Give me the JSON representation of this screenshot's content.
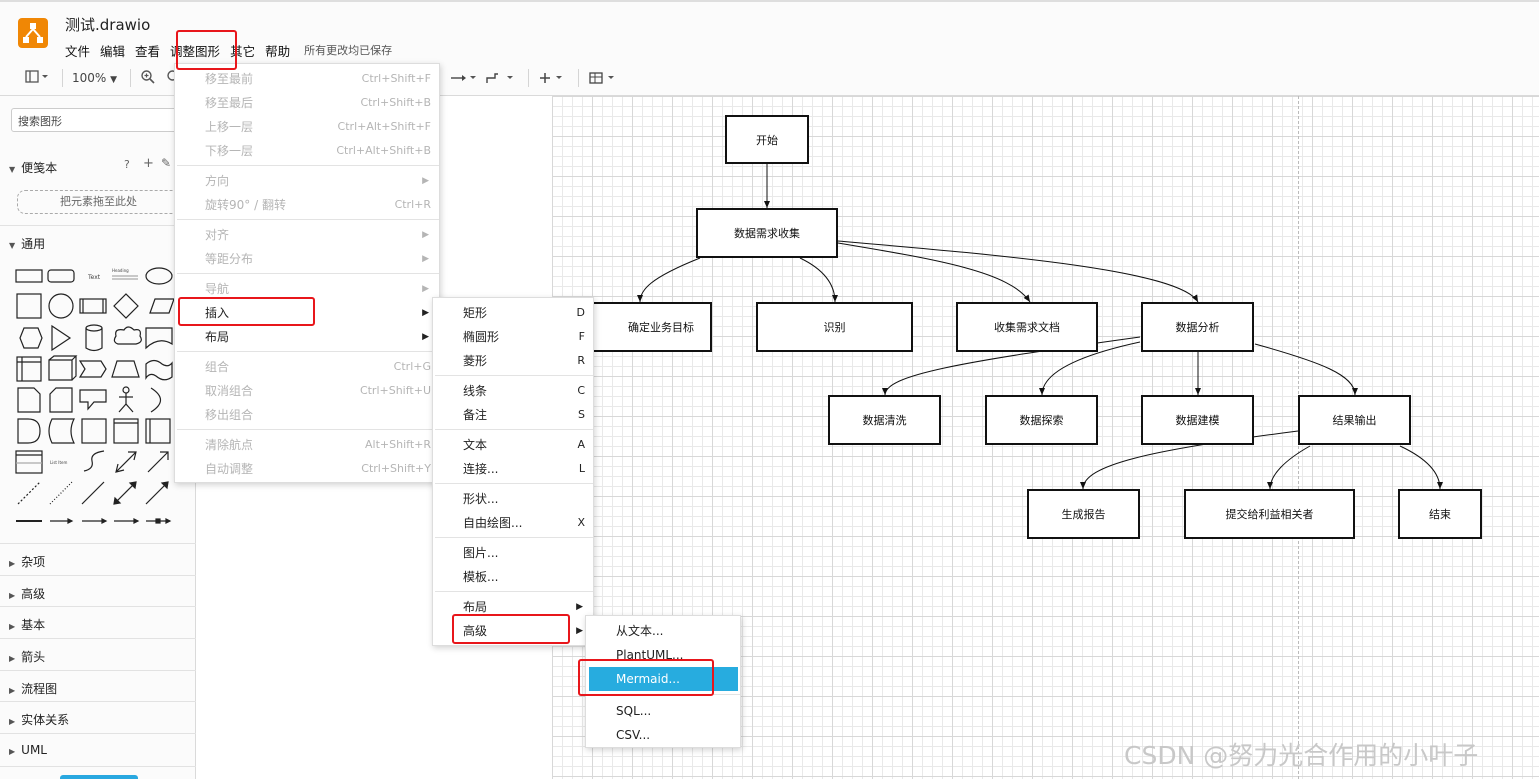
{
  "app": {
    "title": "测试.drawio",
    "saved_status": "所有更改均已保存"
  },
  "colors": {
    "brand": "#f08705",
    "highlight": "#27acdf",
    "annotation_red": "#e8161b"
  },
  "menubar": [
    "文件",
    "编辑",
    "查看",
    "调整图形",
    "其它",
    "帮助"
  ],
  "toolbar": {
    "zoom": "100%"
  },
  "sidebar": {
    "search_placeholder": "搜索图形",
    "scratchpad": "便笺本",
    "drop_hint": "把元素拖至此处",
    "general": "通用",
    "sections": [
      "杂项",
      "高级",
      "基本",
      "箭头",
      "流程图",
      "实体关系",
      "UML"
    ],
    "shape_text_sample": "Text",
    "shape_heading_sample": "Heading",
    "shape_list_sample": "List Item"
  },
  "arrange_menu": {
    "items": [
      {
        "label": "移至最前",
        "shortcut": "Ctrl+Shift+F",
        "disabled": true
      },
      {
        "label": "移至最后",
        "shortcut": "Ctrl+Shift+B",
        "disabled": true
      },
      {
        "label": "上移一层",
        "shortcut": "Ctrl+Alt+Shift+F",
        "disabled": true
      },
      {
        "label": "下移一层",
        "shortcut": "Ctrl+Alt+Shift+B",
        "disabled": true
      },
      {
        "label": "方向",
        "shortcut": "",
        "disabled": true,
        "submenu": true
      },
      {
        "label": "旋转90° / 翻转",
        "shortcut": "Ctrl+R",
        "disabled": true
      },
      {
        "label": "对齐",
        "shortcut": "",
        "disabled": true,
        "submenu": true
      },
      {
        "label": "等距分布",
        "shortcut": "",
        "disabled": true,
        "submenu": true
      },
      {
        "label": "导航",
        "shortcut": "",
        "disabled": true,
        "submenu": true
      },
      {
        "label": "插入",
        "shortcut": "",
        "disabled": false,
        "submenu": true
      },
      {
        "label": "布局",
        "shortcut": "",
        "disabled": false,
        "submenu": true
      },
      {
        "label": "组合",
        "shortcut": "Ctrl+G",
        "disabled": true
      },
      {
        "label": "取消组合",
        "shortcut": "Ctrl+Shift+U",
        "disabled": true
      },
      {
        "label": "移出组合",
        "shortcut": "",
        "disabled": true
      },
      {
        "label": "清除航点",
        "shortcut": "Alt+Shift+R",
        "disabled": true
      },
      {
        "label": "自动调整",
        "shortcut": "Ctrl+Shift+Y",
        "disabled": true
      }
    ]
  },
  "insert_menu": {
    "items": [
      {
        "label": "矩形",
        "shortcut": "D"
      },
      {
        "label": "椭圆形",
        "shortcut": "F"
      },
      {
        "label": "菱形",
        "shortcut": "R"
      },
      {
        "label": "线条",
        "shortcut": "C"
      },
      {
        "label": "备注",
        "shortcut": "S"
      },
      {
        "label": "文本",
        "shortcut": "A"
      },
      {
        "label": "连接...",
        "shortcut": "L"
      },
      {
        "label": "形状...",
        "shortcut": ""
      },
      {
        "label": "自由绘图...",
        "shortcut": "X"
      },
      {
        "label": "图片...",
        "shortcut": ""
      },
      {
        "label": "模板...",
        "shortcut": ""
      },
      {
        "label": "布局",
        "shortcut": ""
      },
      {
        "label": "高级",
        "shortcut": ""
      }
    ]
  },
  "advanced_menu": {
    "items": [
      {
        "label": "从文本..."
      },
      {
        "label": "PlantUML..."
      },
      {
        "label": "Mermaid..."
      },
      {
        "label": "SQL..."
      },
      {
        "label": "CSV..."
      }
    ]
  },
  "diagram": {
    "nodes": {
      "start": "开始",
      "collect": "数据需求收集",
      "goal": "确定业务目标",
      "identify": "识别",
      "docs": "收集需求文档",
      "analysis": "数据分析",
      "clean": "数据清洗",
      "explore": "数据探索",
      "model": "数据建模",
      "output": "结果输出",
      "report": "生成报告",
      "submit": "提交给利益相关者",
      "end": "结束"
    }
  },
  "watermark": "CSDN @努力光合作用的小叶子"
}
